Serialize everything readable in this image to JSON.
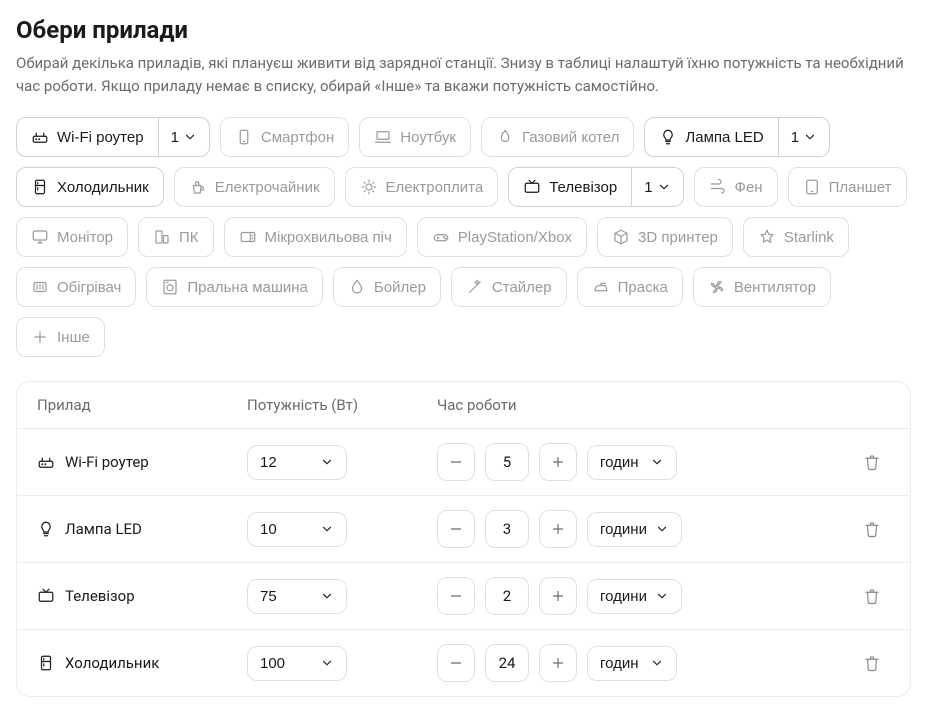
{
  "title": "Обери прилади",
  "subtitle": "Обирай декілька приладів, які плануєш живити від зарядної станції. Знизу в таблиці налаштуй їхню потужність та необхідний час роботи. Якщо приладу немає в списку, обирай «Інше» та вкажи потужність самостійно.",
  "chips": [
    {
      "id": "wifi",
      "label": "Wi-Fi роутер",
      "icon": "router",
      "active": true,
      "count": "1"
    },
    {
      "id": "smartphone",
      "label": "Смартфон",
      "icon": "smartphone",
      "active": false
    },
    {
      "id": "laptop",
      "label": "Ноутбук",
      "icon": "laptop",
      "active": false
    },
    {
      "id": "gasboiler",
      "label": "Газовий котел",
      "icon": "flame",
      "active": false
    },
    {
      "id": "lampled",
      "label": "Лампа LED",
      "icon": "bulb",
      "active": true,
      "count": "1"
    },
    {
      "id": "fridge",
      "label": "Холодильник",
      "icon": "fridge",
      "active": true
    },
    {
      "id": "kettle",
      "label": "Електрочайник",
      "icon": "kettle",
      "active": false
    },
    {
      "id": "stove",
      "label": "Електроплита",
      "icon": "sun",
      "active": false
    },
    {
      "id": "tv",
      "label": "Телевізор",
      "icon": "tv",
      "active": true,
      "count": "1"
    },
    {
      "id": "hairdryer",
      "label": "Фен",
      "icon": "wind",
      "active": false
    },
    {
      "id": "tablet",
      "label": "Планшет",
      "icon": "tablet",
      "active": false
    },
    {
      "id": "monitor",
      "label": "Монітор",
      "icon": "monitor",
      "active": false
    },
    {
      "id": "pc",
      "label": "ПК",
      "icon": "pc",
      "active": false
    },
    {
      "id": "microwave",
      "label": "Мікрохвильова піч",
      "icon": "microwave",
      "active": false
    },
    {
      "id": "console",
      "label": "PlayStation/Xbox",
      "icon": "gamepad",
      "active": false
    },
    {
      "id": "printer3d",
      "label": "3D принтер",
      "icon": "cube",
      "active": false
    },
    {
      "id": "starlink",
      "label": "Starlink",
      "icon": "star",
      "active": false
    },
    {
      "id": "heater",
      "label": "Обігрівач",
      "icon": "heater",
      "active": false
    },
    {
      "id": "washer",
      "label": "Пральна машина",
      "icon": "washer",
      "active": false
    },
    {
      "id": "boiler",
      "label": "Бойлер",
      "icon": "droplet",
      "active": false
    },
    {
      "id": "styler",
      "label": "Стайлер",
      "icon": "wand",
      "active": false
    },
    {
      "id": "iron",
      "label": "Праска",
      "icon": "iron",
      "active": false
    },
    {
      "id": "fan",
      "label": "Вентилятор",
      "icon": "fan",
      "active": false
    },
    {
      "id": "other",
      "label": "Інше",
      "icon": "plus",
      "active": false
    }
  ],
  "table": {
    "headers": {
      "device": "Прилад",
      "power": "Потужність (Вт)",
      "time": "Час роботи"
    },
    "rows": [
      {
        "icon": "router",
        "label": "Wi-Fi роутер",
        "power": "12",
        "hours": "5",
        "unit": "годин"
      },
      {
        "icon": "bulb",
        "label": "Лампа LED",
        "power": "10",
        "hours": "3",
        "unit": "години"
      },
      {
        "icon": "tv",
        "label": "Телевізор",
        "power": "75",
        "hours": "2",
        "unit": "години"
      },
      {
        "icon": "fridge",
        "label": "Холодильник",
        "power": "100",
        "hours": "24",
        "unit": "годин"
      }
    ]
  }
}
